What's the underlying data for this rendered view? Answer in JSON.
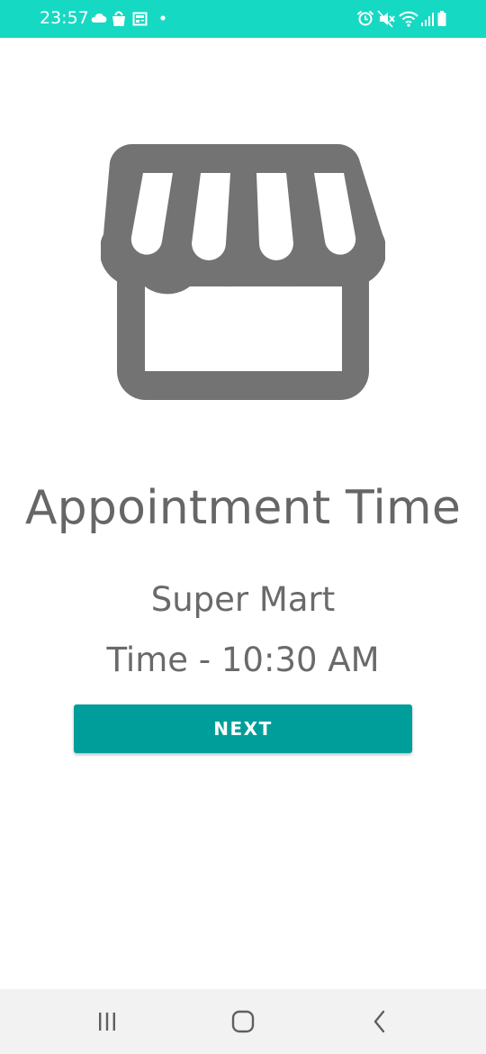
{
  "status_bar": {
    "time": "23:57",
    "background_color": "#16d9c3",
    "left_icons": [
      "cloud-icon",
      "shopping-bag-icon",
      "news-icon",
      "dot-icon"
    ],
    "right_icons": [
      "alarm-icon",
      "mute-icon",
      "wifi-icon",
      "signal-icon",
      "battery-icon"
    ]
  },
  "main": {
    "icon": "store-icon",
    "icon_color": "#737373",
    "title": "Appointment Time",
    "store_name": "Super Mart",
    "time_text": "Time - 10:30 AM",
    "next_label": "NEXT",
    "accent_color": "#009e9a"
  },
  "nav_bar": {
    "icons": [
      "recents-icon",
      "home-icon",
      "back-icon"
    ]
  }
}
